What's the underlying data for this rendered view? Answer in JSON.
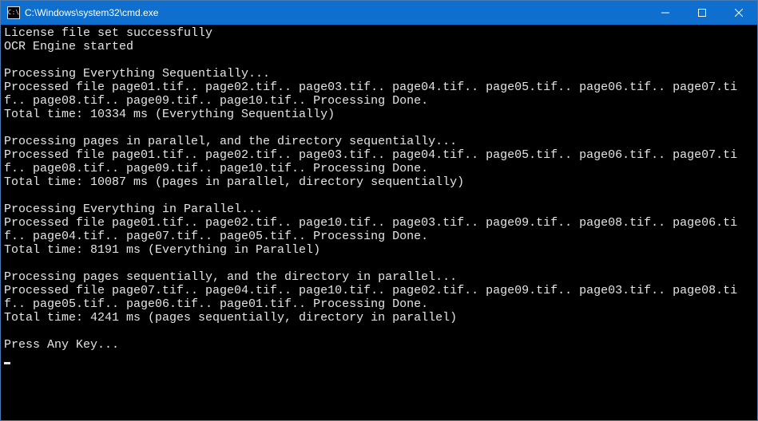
{
  "window": {
    "title": "C:\\Windows\\system32\\cmd.exe"
  },
  "output": {
    "lines": {
      "l0": "License file set successfully",
      "l1": "OCR Engine started",
      "l2": "",
      "l3": "Processing Everything Sequentially...",
      "l4": "Processed file page01.tif.. page02.tif.. page03.tif.. page04.tif.. page05.tif.. page06.tif.. page07.tif.. page08.tif.. page09.tif.. page10.tif.. Processing Done.",
      "l5": "Total time: 10334 ms (Everything Sequentially)",
      "l6": "",
      "l7": "Processing pages in parallel, and the directory sequentially...",
      "l8": "Processed file page01.tif.. page02.tif.. page03.tif.. page04.tif.. page05.tif.. page06.tif.. page07.tif.. page08.tif.. page09.tif.. page10.tif.. Processing Done.",
      "l9": "Total time: 10087 ms (pages in parallel, directory sequentially)",
      "l10": "",
      "l11": "Processing Everything in Parallel...",
      "l12": "Processed file page01.tif.. page02.tif.. page10.tif.. page03.tif.. page09.tif.. page08.tif.. page06.tif.. page04.tif.. page07.tif.. page05.tif.. Processing Done.",
      "l13": "Total time: 8191 ms (Everything in Parallel)",
      "l14": "",
      "l15": "Processing pages sequentially, and the directory in parallel...",
      "l16": "Processed file page07.tif.. page04.tif.. page10.tif.. page02.tif.. page09.tif.. page03.tif.. page08.tif.. page05.tif.. page06.tif.. page01.tif.. Processing Done.",
      "l17": "Total time: 4241 ms (pages sequentially, directory in parallel)",
      "l18": "",
      "l19": "Press Any Key..."
    }
  }
}
